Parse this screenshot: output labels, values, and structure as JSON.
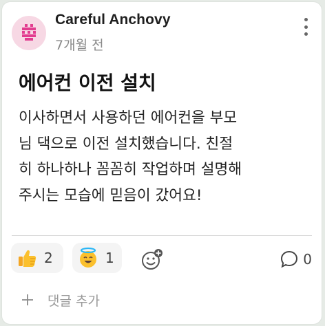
{
  "post": {
    "author": "Careful Anchovy",
    "time": "7개월 전",
    "title": "에어컨 이전 설치",
    "body": "이사하면서 사용하던 에어컨을 부모\n님 댁으로 이전 설치했습니다. 친절\n히 하나하나 꼼꼼히 작업하며 설명해\n주시는 모습에 믿음이 갔어요!",
    "avatar_color": "#e23c8f"
  },
  "reactions": [
    {
      "icon": "thumbs-up-icon",
      "count": "2"
    },
    {
      "icon": "smiling-halo-face-icon",
      "count": "1"
    }
  ],
  "comments": {
    "count": "0",
    "placeholder": "댓글 추가"
  }
}
